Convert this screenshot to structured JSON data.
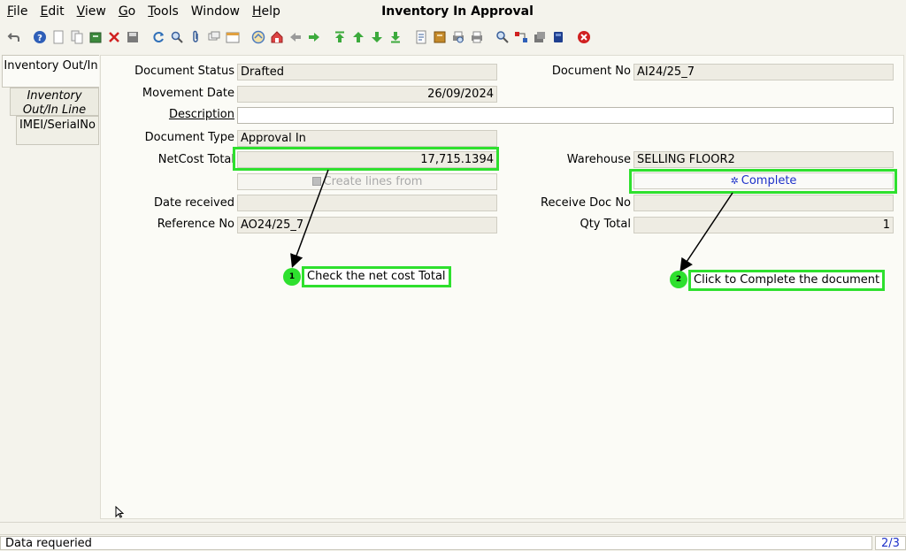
{
  "window": {
    "title": "Inventory In Approval"
  },
  "menu": {
    "file": {
      "key": "F",
      "rest": "ile"
    },
    "edit": {
      "key": "E",
      "rest": "dit"
    },
    "view": {
      "key": "V",
      "rest": "iew"
    },
    "go": {
      "key": "G",
      "rest": "o"
    },
    "tools": {
      "key": "T",
      "rest": "ools"
    },
    "window": {
      "label": "Window"
    },
    "help": {
      "key": "H",
      "rest": "elp"
    }
  },
  "toolbar": {
    "icons": [
      "undo-icon",
      "help-icon",
      "new-record-icon",
      "copy-record-icon",
      "archive-icon",
      "delete-icon",
      "save-icon",
      "refresh-icon",
      "find-icon",
      "attachment-icon",
      "chat-icon",
      "history-icon",
      "home-icon",
      "home-page-icon",
      "back-icon",
      "forward-icon",
      "first-record-icon",
      "previous-record-icon",
      "next-record-icon",
      "last-record-icon",
      "report-icon",
      "archived-documents-icon",
      "print-preview-icon",
      "print-icon",
      "zoom-across-icon",
      "active-workflows-icon",
      "requests-icon",
      "product-info-icon",
      "end-icon"
    ]
  },
  "tabs": [
    {
      "label": "Inventory Out/In"
    },
    {
      "label": "Inventory Out/In Line"
    },
    {
      "label": "IMEI/SerialNo"
    }
  ],
  "form": {
    "document_status": {
      "label": "Document Status",
      "value": "Drafted"
    },
    "document_no": {
      "label": "Document No",
      "value": "AI24/25_7"
    },
    "movement_date": {
      "label": "Movement Date",
      "value": "26/09/2024"
    },
    "description": {
      "label": "Description",
      "value": ""
    },
    "document_type": {
      "label": "Document Type",
      "value": "Approval In"
    },
    "netcost_total": {
      "label": "NetCost Total",
      "value": "17,715.1394"
    },
    "warehouse": {
      "label": "Warehouse",
      "value": "SELLING FLOOR2"
    },
    "create_lines_from": {
      "label": "Create lines from"
    },
    "complete": {
      "label": "Complete"
    },
    "date_received": {
      "label": "Date received",
      "value": ""
    },
    "receive_doc_no": {
      "label": "Receive Doc No",
      "value": ""
    },
    "reference_no": {
      "label": "Reference No",
      "value": "AO24/25_7"
    },
    "qty_total": {
      "label": "Qty Total",
      "value": "1"
    }
  },
  "annotations": [
    {
      "number": "1",
      "text": "Check the net cost Total"
    },
    {
      "number": "2",
      "text": "Click to Complete the document"
    }
  ],
  "status": {
    "message": "Data requeried",
    "page": "2/3"
  },
  "colors": {
    "highlight": "#2ee02e",
    "link": "#1d31c9",
    "field_bg": "#eeece3"
  }
}
